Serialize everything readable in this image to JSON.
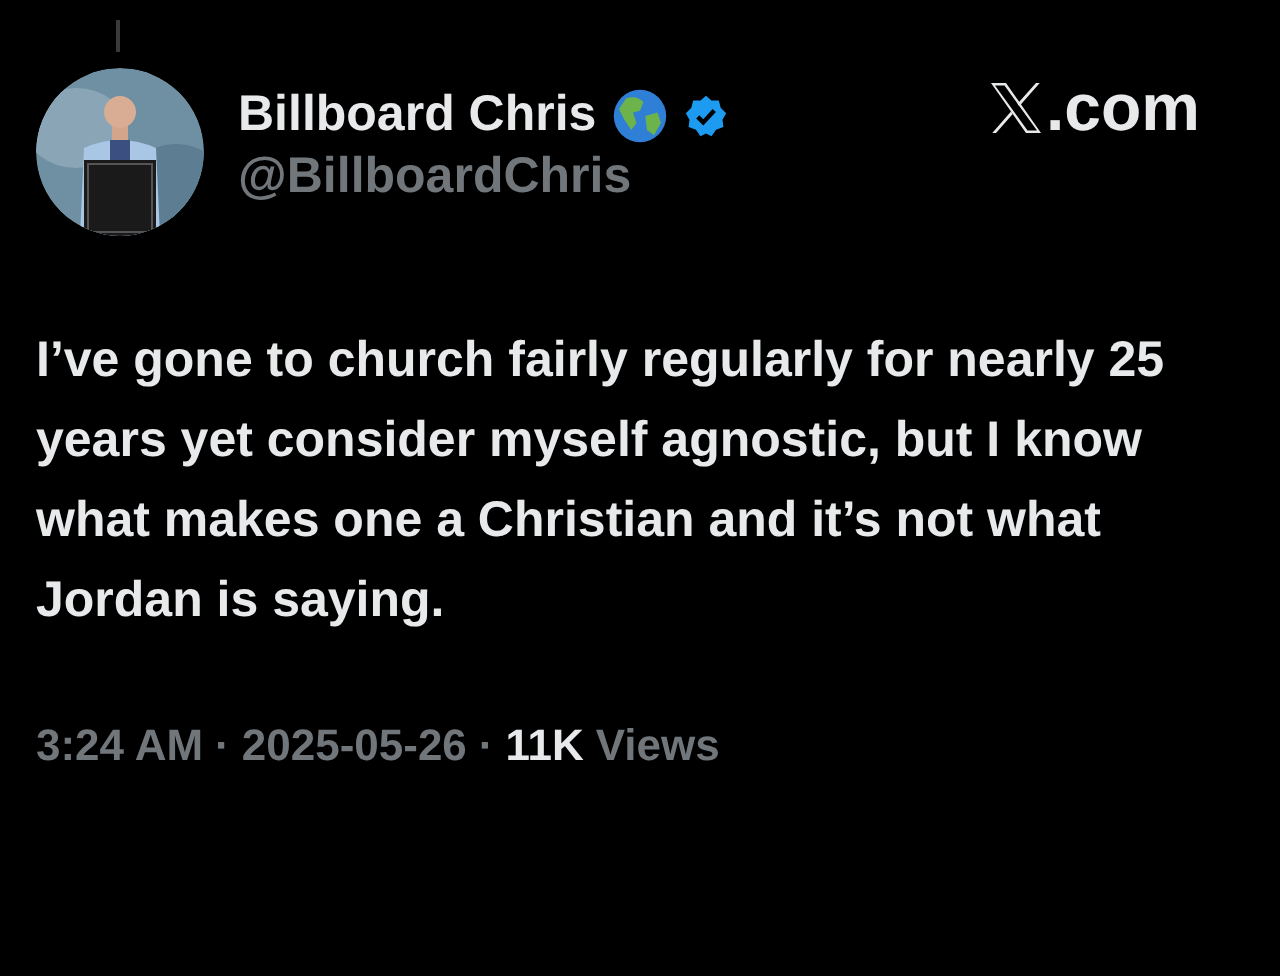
{
  "author": {
    "name": "Billboard Chris",
    "verified": true,
    "handle": "@BillboardChris"
  },
  "brand": {
    "text": ".com"
  },
  "post": {
    "text": "I’ve gone to church fairly regularly for nearly 25 years yet consider myself agnostic, but I know what makes one a Christian and it’s not what Jordan is saying."
  },
  "footer": {
    "time": "3:24 AM",
    "separator": "·",
    "date": "2025-05-26",
    "views_count": "11K",
    "views_label": "Views"
  }
}
